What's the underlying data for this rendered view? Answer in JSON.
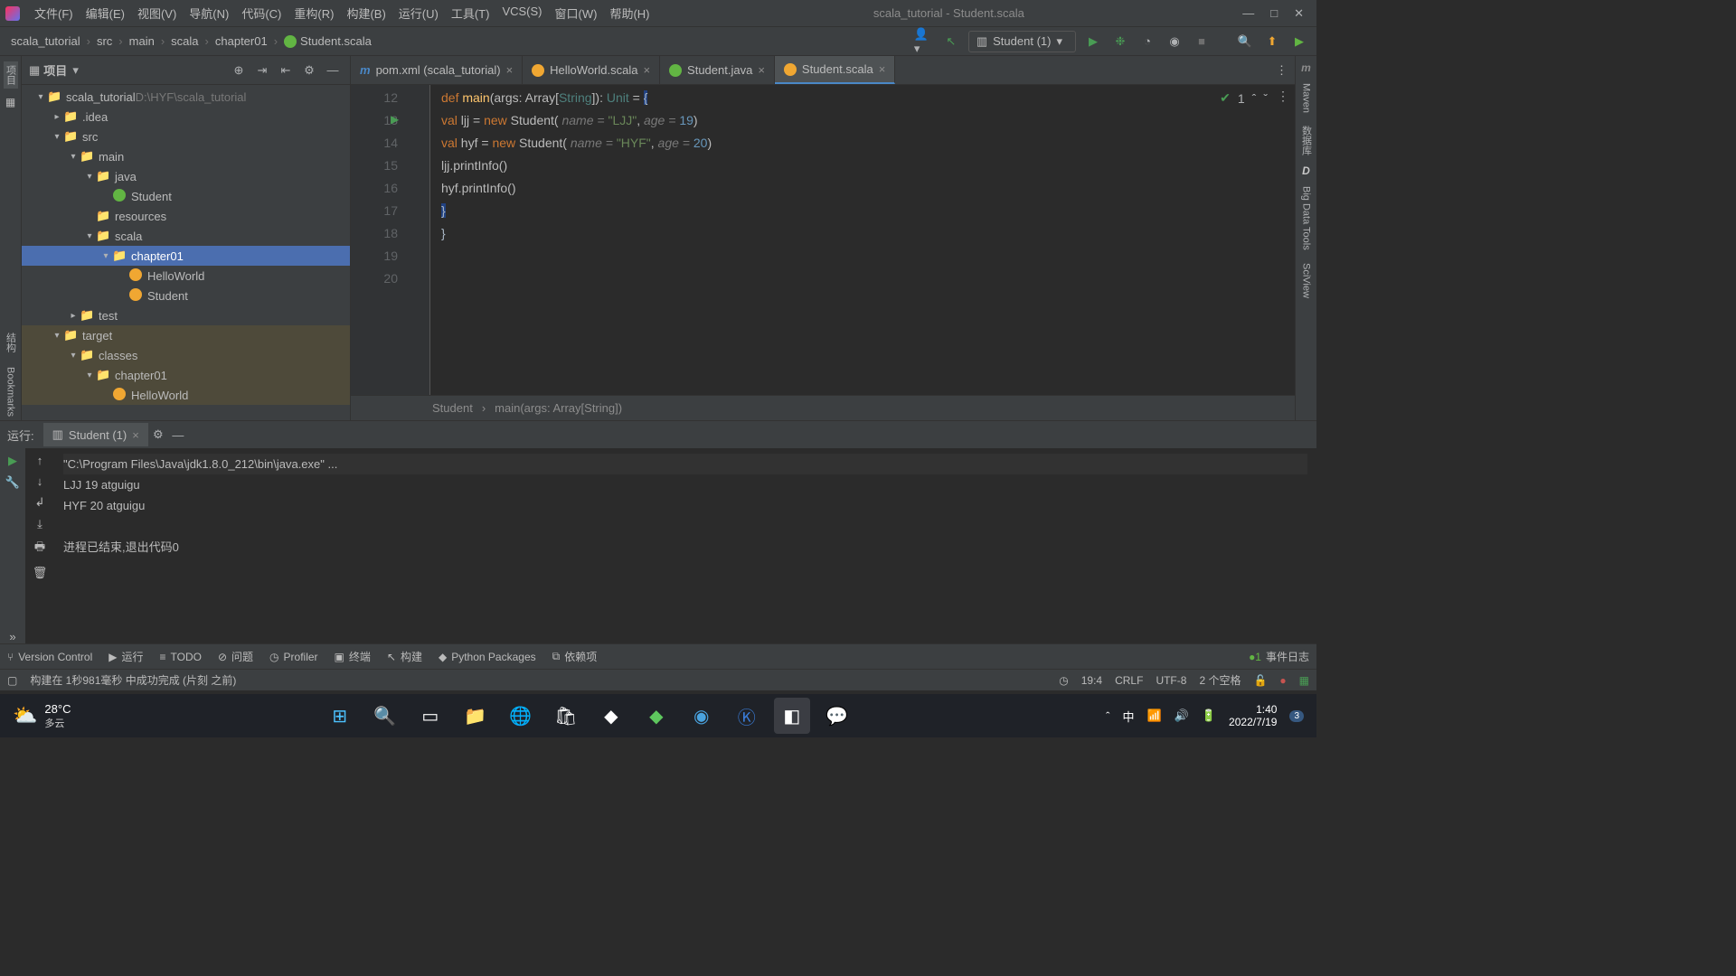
{
  "window": {
    "title": "scala_tutorial - Student.scala"
  },
  "menu": [
    "文件(F)",
    "编辑(E)",
    "视图(V)",
    "导航(N)",
    "代码(C)",
    "重构(R)",
    "构建(B)",
    "运行(U)",
    "工具(T)",
    "VCS(S)",
    "窗口(W)",
    "帮助(H)"
  ],
  "breadcrumbs": [
    "scala_tutorial",
    "src",
    "main",
    "scala",
    "chapter01",
    "Student.scala"
  ],
  "runconfig": "Student (1)",
  "project_label": "项目",
  "project_path": "D:\\HYF\\scala_tutorial",
  "tree": [
    {
      "d": 0,
      "c": "▾",
      "i": "folder",
      "t": "scala_tutorial",
      "suffix": "D:\\HYF\\scala_tutorial"
    },
    {
      "d": 1,
      "c": "▸",
      "i": "folder",
      "t": ".idea"
    },
    {
      "d": 1,
      "c": "▾",
      "i": "folder",
      "t": "src"
    },
    {
      "d": 2,
      "c": "▾",
      "i": "folder",
      "t": "main"
    },
    {
      "d": 3,
      "c": "▾",
      "i": "folder",
      "t": "java"
    },
    {
      "d": 4,
      "c": "",
      "i": "circle-c",
      "t": "Student"
    },
    {
      "d": 3,
      "c": "",
      "i": "folder",
      "t": "resources"
    },
    {
      "d": 3,
      "c": "▾",
      "i": "folder",
      "t": "scala"
    },
    {
      "d": 4,
      "c": "▾",
      "i": "folder",
      "t": "chapter01",
      "sel": true
    },
    {
      "d": 5,
      "c": "",
      "i": "circle-o",
      "t": "HelloWorld"
    },
    {
      "d": 5,
      "c": "",
      "i": "circle-o",
      "t": "Student"
    },
    {
      "d": 2,
      "c": "▸",
      "i": "folder",
      "t": "test"
    },
    {
      "d": 1,
      "c": "▾",
      "i": "folder-orange",
      "t": "target",
      "tg": true
    },
    {
      "d": 2,
      "c": "▾",
      "i": "folder-orange",
      "t": "classes",
      "tg": true
    },
    {
      "d": 3,
      "c": "▾",
      "i": "folder-orange",
      "t": "chapter01",
      "tg": true
    },
    {
      "d": 4,
      "c": "",
      "i": "circle-o",
      "t": "HelloWorld",
      "tg": true
    }
  ],
  "tabs": [
    {
      "icon": "m",
      "label": "pom.xml (scala_tutorial)"
    },
    {
      "icon": "o",
      "label": "HelloWorld.scala"
    },
    {
      "icon": "c",
      "label": "Student.java"
    },
    {
      "icon": "o",
      "label": "Student.scala",
      "active": true
    }
  ],
  "line_start": 12,
  "code_hints": {
    "name": "name = ",
    "age": "age = "
  },
  "code_values": {
    "ljj_name": "\"LJJ\"",
    "ljj_age": "19",
    "hyf_name": "\"HYF\"",
    "hyf_age": "20"
  },
  "inspection_count": "1",
  "bc_bar": [
    "Student",
    "main(args: Array[String])"
  ],
  "right_tools": [
    "Maven",
    "数据库",
    "Big Data Tools",
    "SciView"
  ],
  "run": {
    "label": "运行:",
    "tab": "Student (1)",
    "lines": [
      "\"C:\\Program Files\\Java\\jdk1.8.0_212\\bin\\java.exe\" ...",
      "LJJ 19 atguigu",
      "HYF 20 atguigu",
      "",
      "进程已结束,退出代码0"
    ]
  },
  "toolwindows": [
    "Version Control",
    "运行",
    "TODO",
    "问题",
    "Profiler",
    "终端",
    "构建",
    "Python Packages",
    "依赖项"
  ],
  "event_log": "事件日志",
  "status": {
    "msg": "构建在 1秒981毫秒 中成功完成 (片刻 之前)",
    "pos": "19:4",
    "eol": "CRLF",
    "enc": "UTF-8",
    "indent": "2 个空格"
  },
  "left_tools": [
    "项目",
    "结构",
    "Bookmarks"
  ],
  "taskbar": {
    "temp": "28°C",
    "weather": "多云",
    "time": "1:40",
    "date": "2022/7/19",
    "lang": "中",
    "notif": "3"
  }
}
